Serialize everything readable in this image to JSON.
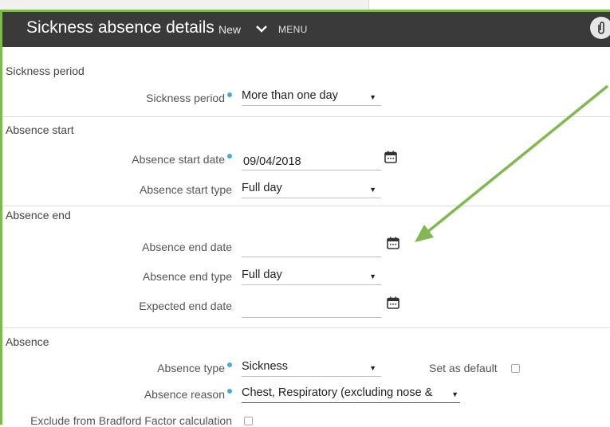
{
  "header": {
    "title": "Sickness absence details",
    "badge": "New",
    "menu_label": "MENU"
  },
  "sections": {
    "sickness_period": "Sickness period",
    "absence_start": "Absence start",
    "absence_end": "Absence end",
    "absence": "Absence"
  },
  "fields": {
    "sickness_period": {
      "label": "Sickness period",
      "value": "More than one day"
    },
    "absence_start_date": {
      "label": "Absence start date",
      "value": "09/04/2018"
    },
    "absence_start_type": {
      "label": "Absence start type",
      "value": "Full day"
    },
    "absence_end_date": {
      "label": "Absence end date",
      "value": ""
    },
    "absence_end_type": {
      "label": "Absence end type",
      "value": "Full day"
    },
    "expected_end_date": {
      "label": "Expected end date",
      "value": ""
    },
    "absence_type": {
      "label": "Absence type",
      "value": "Sickness"
    },
    "set_as_default": {
      "label": "Set as default"
    },
    "absence_reason": {
      "label": "Absence reason",
      "value": "Chest, Respiratory (excluding nose &"
    },
    "exclude_bradford": {
      "label": "Exclude from Bradford Factor calculation"
    }
  },
  "colors": {
    "header_bg": "#3a3a3a",
    "frame_accent": "#7fb94f",
    "required_dot": "#4aa8d8",
    "arrow": "#7fb94f"
  },
  "icons": [
    "chevron-down-icon",
    "paperclip-icon",
    "calendar-icon",
    "dropdown-caret-icon"
  ]
}
